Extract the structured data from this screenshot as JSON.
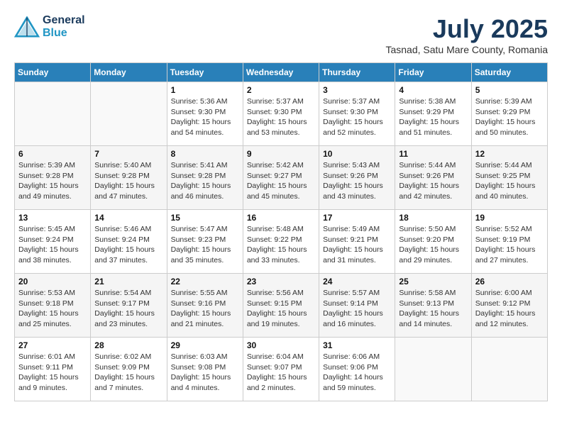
{
  "logo": {
    "line1": "General",
    "line2": "Blue"
  },
  "title": "July 2025",
  "subtitle": "Tasnad, Satu Mare County, Romania",
  "weekdays": [
    "Sunday",
    "Monday",
    "Tuesday",
    "Wednesday",
    "Thursday",
    "Friday",
    "Saturday"
  ],
  "weeks": [
    [
      {
        "day": "",
        "info": ""
      },
      {
        "day": "",
        "info": ""
      },
      {
        "day": "1",
        "info": "Sunrise: 5:36 AM\nSunset: 9:30 PM\nDaylight: 15 hours\nand 54 minutes."
      },
      {
        "day": "2",
        "info": "Sunrise: 5:37 AM\nSunset: 9:30 PM\nDaylight: 15 hours\nand 53 minutes."
      },
      {
        "day": "3",
        "info": "Sunrise: 5:37 AM\nSunset: 9:30 PM\nDaylight: 15 hours\nand 52 minutes."
      },
      {
        "day": "4",
        "info": "Sunrise: 5:38 AM\nSunset: 9:29 PM\nDaylight: 15 hours\nand 51 minutes."
      },
      {
        "day": "5",
        "info": "Sunrise: 5:39 AM\nSunset: 9:29 PM\nDaylight: 15 hours\nand 50 minutes."
      }
    ],
    [
      {
        "day": "6",
        "info": "Sunrise: 5:39 AM\nSunset: 9:28 PM\nDaylight: 15 hours\nand 49 minutes."
      },
      {
        "day": "7",
        "info": "Sunrise: 5:40 AM\nSunset: 9:28 PM\nDaylight: 15 hours\nand 47 minutes."
      },
      {
        "day": "8",
        "info": "Sunrise: 5:41 AM\nSunset: 9:28 PM\nDaylight: 15 hours\nand 46 minutes."
      },
      {
        "day": "9",
        "info": "Sunrise: 5:42 AM\nSunset: 9:27 PM\nDaylight: 15 hours\nand 45 minutes."
      },
      {
        "day": "10",
        "info": "Sunrise: 5:43 AM\nSunset: 9:26 PM\nDaylight: 15 hours\nand 43 minutes."
      },
      {
        "day": "11",
        "info": "Sunrise: 5:44 AM\nSunset: 9:26 PM\nDaylight: 15 hours\nand 42 minutes."
      },
      {
        "day": "12",
        "info": "Sunrise: 5:44 AM\nSunset: 9:25 PM\nDaylight: 15 hours\nand 40 minutes."
      }
    ],
    [
      {
        "day": "13",
        "info": "Sunrise: 5:45 AM\nSunset: 9:24 PM\nDaylight: 15 hours\nand 38 minutes."
      },
      {
        "day": "14",
        "info": "Sunrise: 5:46 AM\nSunset: 9:24 PM\nDaylight: 15 hours\nand 37 minutes."
      },
      {
        "day": "15",
        "info": "Sunrise: 5:47 AM\nSunset: 9:23 PM\nDaylight: 15 hours\nand 35 minutes."
      },
      {
        "day": "16",
        "info": "Sunrise: 5:48 AM\nSunset: 9:22 PM\nDaylight: 15 hours\nand 33 minutes."
      },
      {
        "day": "17",
        "info": "Sunrise: 5:49 AM\nSunset: 9:21 PM\nDaylight: 15 hours\nand 31 minutes."
      },
      {
        "day": "18",
        "info": "Sunrise: 5:50 AM\nSunset: 9:20 PM\nDaylight: 15 hours\nand 29 minutes."
      },
      {
        "day": "19",
        "info": "Sunrise: 5:52 AM\nSunset: 9:19 PM\nDaylight: 15 hours\nand 27 minutes."
      }
    ],
    [
      {
        "day": "20",
        "info": "Sunrise: 5:53 AM\nSunset: 9:18 PM\nDaylight: 15 hours\nand 25 minutes."
      },
      {
        "day": "21",
        "info": "Sunrise: 5:54 AM\nSunset: 9:17 PM\nDaylight: 15 hours\nand 23 minutes."
      },
      {
        "day": "22",
        "info": "Sunrise: 5:55 AM\nSunset: 9:16 PM\nDaylight: 15 hours\nand 21 minutes."
      },
      {
        "day": "23",
        "info": "Sunrise: 5:56 AM\nSunset: 9:15 PM\nDaylight: 15 hours\nand 19 minutes."
      },
      {
        "day": "24",
        "info": "Sunrise: 5:57 AM\nSunset: 9:14 PM\nDaylight: 15 hours\nand 16 minutes."
      },
      {
        "day": "25",
        "info": "Sunrise: 5:58 AM\nSunset: 9:13 PM\nDaylight: 15 hours\nand 14 minutes."
      },
      {
        "day": "26",
        "info": "Sunrise: 6:00 AM\nSunset: 9:12 PM\nDaylight: 15 hours\nand 12 minutes."
      }
    ],
    [
      {
        "day": "27",
        "info": "Sunrise: 6:01 AM\nSunset: 9:11 PM\nDaylight: 15 hours\nand 9 minutes."
      },
      {
        "day": "28",
        "info": "Sunrise: 6:02 AM\nSunset: 9:09 PM\nDaylight: 15 hours\nand 7 minutes."
      },
      {
        "day": "29",
        "info": "Sunrise: 6:03 AM\nSunset: 9:08 PM\nDaylight: 15 hours\nand 4 minutes."
      },
      {
        "day": "30",
        "info": "Sunrise: 6:04 AM\nSunset: 9:07 PM\nDaylight: 15 hours\nand 2 minutes."
      },
      {
        "day": "31",
        "info": "Sunrise: 6:06 AM\nSunset: 9:06 PM\nDaylight: 14 hours\nand 59 minutes."
      },
      {
        "day": "",
        "info": ""
      },
      {
        "day": "",
        "info": ""
      }
    ]
  ]
}
